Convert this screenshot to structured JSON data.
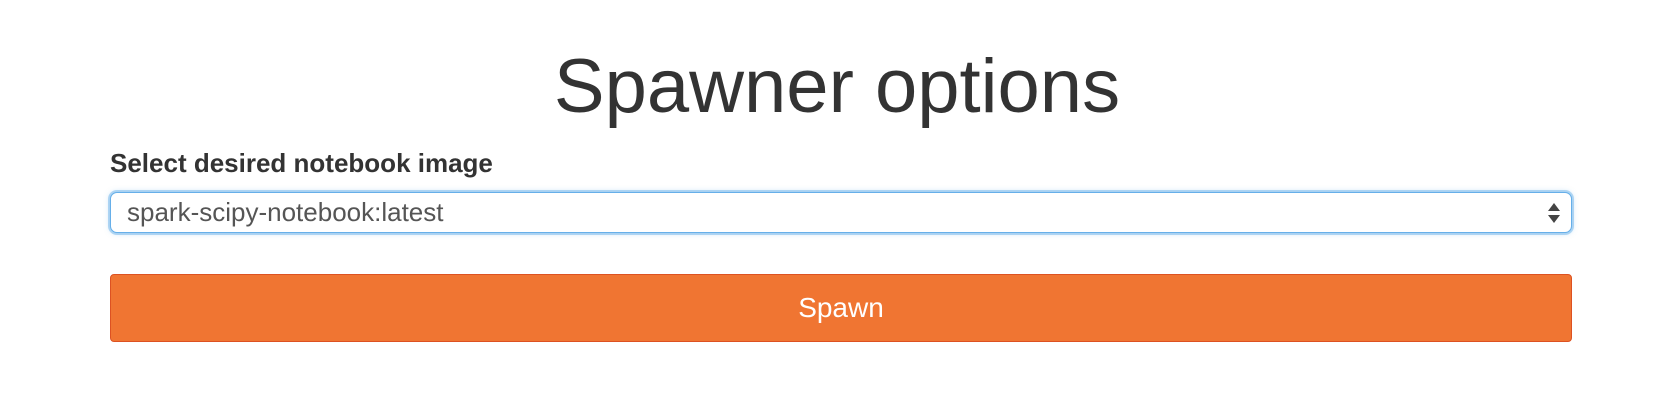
{
  "page": {
    "title": "Spawner options"
  },
  "form": {
    "image_label": "Select desired notebook image",
    "image_select": {
      "selected_value": "spark-scipy-notebook:latest",
      "icon": "chevron-up-down-icon"
    },
    "spawn_button_label": "Spawn"
  },
  "colors": {
    "button_background": "#f07532",
    "button_border": "#dd5222",
    "focus_ring": "#66afe9",
    "text": "#333333"
  }
}
